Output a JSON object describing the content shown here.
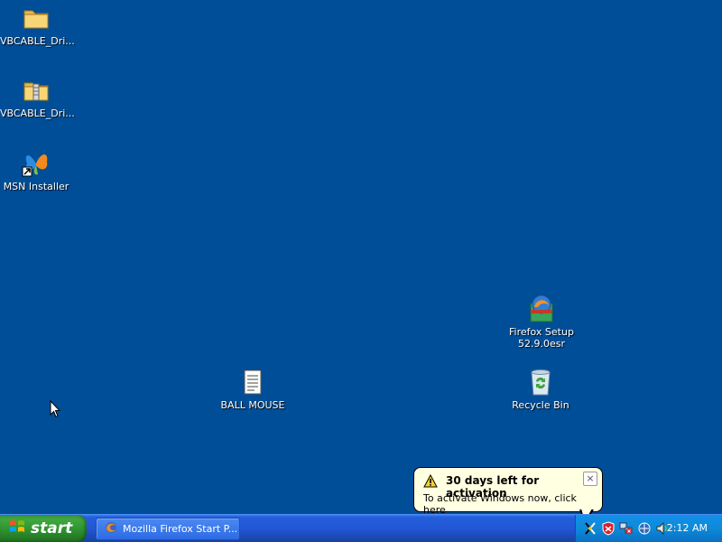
{
  "desktop": {
    "icons": [
      {
        "label": "VBCABLE_Dri...",
        "icon": "folder-icon"
      },
      {
        "label": "VBCABLE_Dri...",
        "icon": "zip-folder-icon"
      },
      {
        "label": "MSN Installer",
        "icon": "msn-butterfly-icon"
      },
      {
        "label": "Firefox Setup\n52.9.0esr",
        "icon": "firefox-setup-icon"
      },
      {
        "label": "BALL MOUSE",
        "icon": "text-document-icon"
      },
      {
        "label": "Recycle Bin",
        "icon": "recycle-bin-icon"
      }
    ],
    "background": "#004e98"
  },
  "balloon": {
    "title": "30 days left for activation",
    "body": "To activate Windows now, click here",
    "close": "×"
  },
  "taskbar": {
    "start_label": "start",
    "task_button": "Mozilla Firefox Start P...",
    "clock": "2:12 AM",
    "tray_icons": [
      "activation-keys-icon",
      "security-shield-icon",
      "network-error-icon",
      "network-icon",
      "volume-icon"
    ]
  }
}
